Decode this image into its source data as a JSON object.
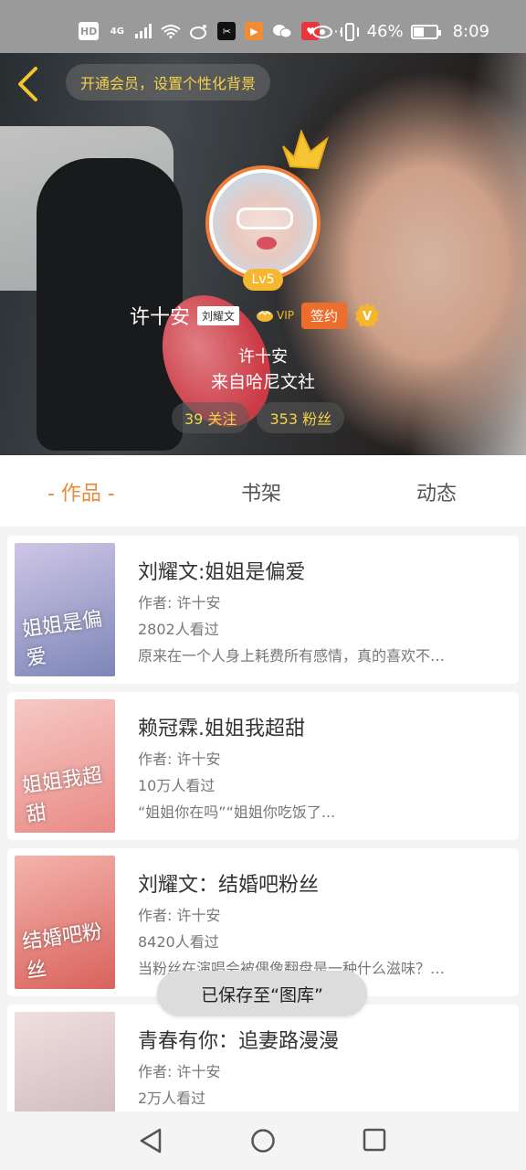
{
  "status_bar": {
    "net1": "HD",
    "net2": "4G",
    "battery": "46%",
    "battery_level": 0.46,
    "time": "8:09"
  },
  "header": {
    "vip_banner": "开通会员，设置个性化背景",
    "level": "Lv5",
    "name": "许十安",
    "tag": "刘耀文",
    "vip_label": "VIP",
    "sign_label": "签约",
    "v_label": "V",
    "nickname": "许十安",
    "from": "来自哈尼文社",
    "following": "39 关注",
    "followers": "353 粉丝"
  },
  "tabs": {
    "works": "- 作品 -",
    "bookshelf": "书架",
    "activity": "动态"
  },
  "works": [
    {
      "title": "刘耀文:姐姐是偏爱",
      "author": "作者: 许十安",
      "views": "2802人看过",
      "desc": "原来在一个人身上耗费所有感情，真的喜欢不…",
      "cover_text": "姐姐是偏爱",
      "cover_colors": [
        "#cfc6e6",
        "#7d86b8"
      ]
    },
    {
      "title": "赖冠霖.姐姐我超甜",
      "author": "作者: 许十安",
      "views": "10万人看过",
      "desc": "“姐姐你在吗”“姐姐你吃饭了...",
      "cover_text": "姐姐我超甜",
      "cover_colors": [
        "#f6c9c4",
        "#e98a86"
      ]
    },
    {
      "title": "刘耀文：结婚吧粉丝",
      "author": "作者: 许十安",
      "views": "8420人看过",
      "desc": "当粉丝在演唱会被偶像翻盘是一种什么滋味？…",
      "cover_text": "结婚吧粉丝",
      "cover_colors": [
        "#f3b4ac",
        "#d9625c"
      ]
    },
    {
      "title": "青春有你：追妻路漫漫",
      "author": "作者: 许十安",
      "views": "2万人看过",
      "desc": "",
      "cover_text": "",
      "cover_colors": [
        "#f1dede",
        "#c8b6bb"
      ]
    }
  ],
  "toast": "已保存至“图库”",
  "colors": {
    "accent": "#ec8a3a",
    "sign": "#ec6d2c",
    "gold": "#f5d24a"
  }
}
